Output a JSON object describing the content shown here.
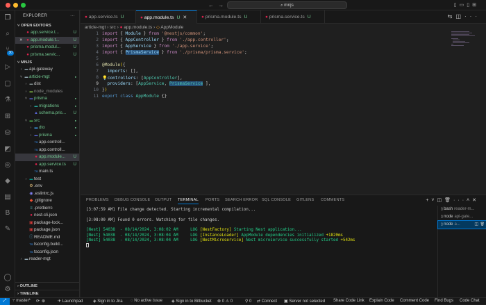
{
  "titlebar": {
    "search_text": "mnjs",
    "nav_back": "←",
    "nav_fwd": "→"
  },
  "activity": {
    "scm_badge": "30"
  },
  "sidebar": {
    "title": "EXPLORER",
    "open_editors_label": "OPEN EDITORS",
    "open_editors": [
      {
        "name": "app.service.t...",
        "status": "U",
        "close": false
      },
      {
        "name": "app.module.t...",
        "status": "U",
        "close": true,
        "selected": true
      },
      {
        "name": "prisma.modul...",
        "status": "U",
        "close": false
      },
      {
        "name": "prisma.servic...",
        "status": "U",
        "close": false
      }
    ],
    "workspace_label": "MNJS",
    "tree": [
      {
        "name": "api-gateway",
        "kind": "folder",
        "depth": 1,
        "open": false,
        "color": "#cccccc"
      },
      {
        "name": "article-mgt",
        "kind": "folder",
        "depth": 1,
        "open": true,
        "color": "#73c991"
      },
      {
        "name": "dist",
        "kind": "folder",
        "depth": 2,
        "open": false,
        "color": "#cccccc"
      },
      {
        "name": "node_modules",
        "kind": "folder",
        "depth": 2,
        "open": false,
        "color": "#8b8b8b"
      },
      {
        "name": "prisma",
        "kind": "folder",
        "depth": 2,
        "open": true,
        "color": "#73c991"
      },
      {
        "name": "migrations",
        "kind": "folder",
        "depth": 3,
        "open": false,
        "color": "#73c991"
      },
      {
        "name": "schema.pris...",
        "kind": "prisma",
        "depth": 3,
        "color": "#73c991",
        "status": "U"
      },
      {
        "name": "src",
        "kind": "folder",
        "depth": 2,
        "open": true,
        "color": "#73c991"
      },
      {
        "name": "dto",
        "kind": "folder",
        "depth": 3,
        "open": false,
        "color": "#73c991"
      },
      {
        "name": "prisma",
        "kind": "folder",
        "depth": 3,
        "open": false,
        "color": "#73c991"
      },
      {
        "name": "app.controll...",
        "kind": "ts",
        "depth": 3,
        "color": "#cccccc"
      },
      {
        "name": "app.controll...",
        "kind": "ts",
        "depth": 3,
        "color": "#cccccc"
      },
      {
        "name": "app.module...",
        "kind": "nest",
        "depth": 3,
        "color": "#73c991",
        "status": "U",
        "selected": true
      },
      {
        "name": "app.service.ts",
        "kind": "nest",
        "depth": 3,
        "color": "#73c991",
        "status": "U"
      },
      {
        "name": "main.ts",
        "kind": "ts",
        "depth": 3,
        "color": "#cccccc"
      },
      {
        "name": "test",
        "kind": "folder",
        "depth": 2,
        "open": false,
        "color": "#cccccc"
      },
      {
        "name": ".env",
        "kind": "env",
        "depth": 2,
        "color": "#cccccc"
      },
      {
        "name": ".eslintrc.js",
        "kind": "eslint",
        "depth": 2,
        "color": "#cccccc"
      },
      {
        "name": ".gitignore",
        "kind": "git",
        "depth": 2,
        "color": "#cccccc"
      },
      {
        "name": ".prettierrc",
        "kind": "prettier",
        "depth": 2,
        "color": "#cccccc"
      },
      {
        "name": "nest-cli.json",
        "kind": "nest",
        "depth": 2,
        "color": "#cccccc"
      },
      {
        "name": "package-lock...",
        "kind": "npm",
        "depth": 2,
        "color": "#cccccc"
      },
      {
        "name": "package.json",
        "kind": "npm",
        "depth": 2,
        "color": "#cccccc"
      },
      {
        "name": "README.md",
        "kind": "md",
        "depth": 2,
        "color": "#cccccc"
      },
      {
        "name": "tsconfig.build...",
        "kind": "tsconfig",
        "depth": 2,
        "color": "#cccccc"
      },
      {
        "name": "tsconfig.json",
        "kind": "tsconfig",
        "depth": 2,
        "color": "#cccccc"
      },
      {
        "name": "reader-mgt",
        "kind": "folder",
        "depth": 1,
        "open": false,
        "color": "#cccccc"
      }
    ],
    "outline_label": "OUTLINE",
    "timeline_label": "TIMELINE"
  },
  "tabs": [
    {
      "name": "app.service.ts",
      "status": "U",
      "active": false
    },
    {
      "name": "app.module.ts",
      "status": "U",
      "active": true
    },
    {
      "name": "prisma.module.ts",
      "status": "U",
      "active": false
    },
    {
      "name": "prisma.service.ts",
      "status": "U",
      "active": false
    }
  ],
  "breadcrumb": [
    "article-mgt",
    "src",
    "app.module.ts",
    "AppModule"
  ],
  "code": {
    "line_numbers": [
      "1",
      "2",
      "3",
      "4",
      "5",
      "6",
      "7",
      "8",
      "9",
      "10",
      "11"
    ],
    "current_line": "9"
  },
  "panel": {
    "tabs": [
      "PROBLEMS",
      "DEBUG CONSOLE",
      "OUTPUT",
      "TERMINAL",
      "PORTS",
      "SEARCH ERROR",
      "SQL CONSOLE",
      "GITLENS",
      "COMMENTS"
    ],
    "active_tab": "TERMINAL",
    "terminal_lines": [
      {
        "text": "[3:07:59 AM] File change detected. Starting incremental compilation..."
      },
      {
        "text": ""
      },
      {
        "text": "[3:08:00 AM] Found 0 errors. Watching for file changes."
      },
      {
        "text": ""
      },
      {
        "prefix": "[Nest] 54038  - 08/14/2024, 3:08:02 AM     LOG ",
        "ctx": "[NestFactory]",
        "msg": " Starting Nest application...",
        "time": ""
      },
      {
        "prefix": "[Nest] 54038  - 08/14/2024, 3:08:04 AM     LOG ",
        "ctx": "[InstanceLoader]",
        "msg": " AppModule dependencies initialized ",
        "time": "+1820ms"
      },
      {
        "prefix": "[Nest] 54038  - 08/14/2024, 3:08:04 AM     LOG ",
        "ctx": "[NestMicroservice]",
        "msg": " Nest microservice successfully started ",
        "time": "+542ms"
      }
    ],
    "terminals": [
      {
        "name": "bash",
        "sub": "reader-m..."
      },
      {
        "name": "node",
        "sub": "api-gate..."
      },
      {
        "name": "node",
        "sub": "a...",
        "selected": true
      }
    ]
  },
  "status": {
    "branch": "master*",
    "launchpad": "Launchpad",
    "jira": "Sign in to Jira",
    "issue": "No active issue",
    "bitbucket": "Sign in to Bitbucket",
    "errors": "0",
    "warnings": "0",
    "connect": "Connect",
    "server": "Server not selected",
    "share": "Share Code Link",
    "explain": "Explain Code",
    "comment": "Comment Code",
    "bugs": "Find Bugs",
    "chat": "Code Chat"
  }
}
